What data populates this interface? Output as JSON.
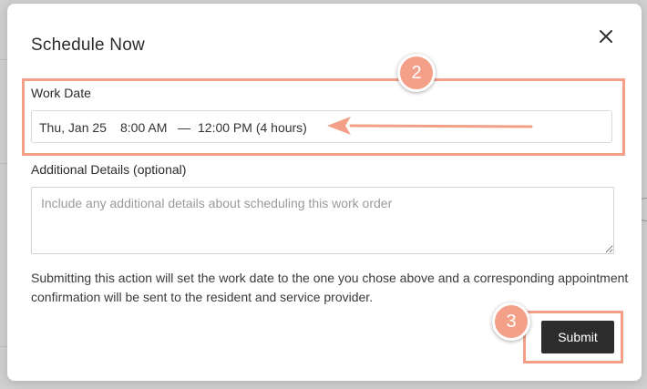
{
  "modal": {
    "title": "Schedule Now",
    "close_icon": "close-icon"
  },
  "work_date": {
    "label": "Work Date",
    "date": "Thu, Jan 25",
    "start_time": "8:00 AM",
    "separator": "—",
    "end_time": "12:00 PM (4 hours)"
  },
  "details": {
    "label": "Additional Details (optional)",
    "placeholder": "Include any additional details about scheduling this work order"
  },
  "info_text": "Submitting this action will set the work date to the one you chose above and a corresponding appointment confirmation will be sent to the resident and service provider.",
  "submit_label": "Submit",
  "annotations": {
    "step_work_date": "2",
    "step_submit": "3",
    "accent_color": "#f4a089"
  }
}
